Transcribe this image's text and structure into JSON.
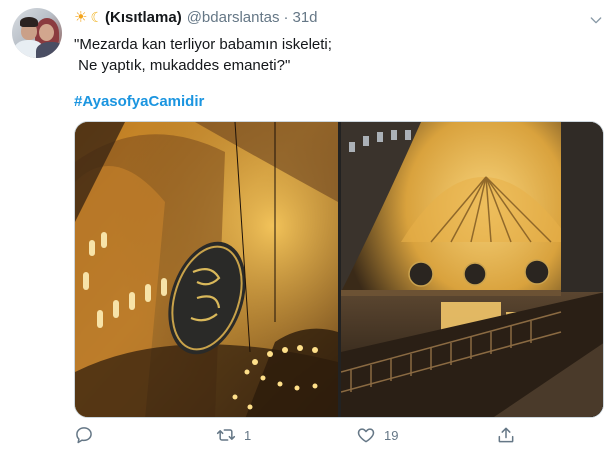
{
  "tweet": {
    "display_name": "(Kısıtlama)",
    "handle": "@bdarslantas",
    "separator": "·",
    "time": "31d",
    "lines": [
      "\"Mezarda kan terliyor babamın iskeleti;",
      " Ne yaptık, mukaddes emaneti?\""
    ],
    "hashtag": "#AyasofyaCamidir",
    "retweet_count": "1",
    "like_count": "19"
  },
  "icons": {
    "name_emojis": [
      "sun-icon",
      "crescent-moon-icon"
    ],
    "more": "chevron-down-icon",
    "reply": "reply-icon",
    "retweet": "retweet-icon",
    "like": "heart-icon",
    "share": "share-icon"
  },
  "colors": {
    "link": "#1b95e0",
    "secondary_text": "#657786",
    "primary_text": "#14171a"
  }
}
